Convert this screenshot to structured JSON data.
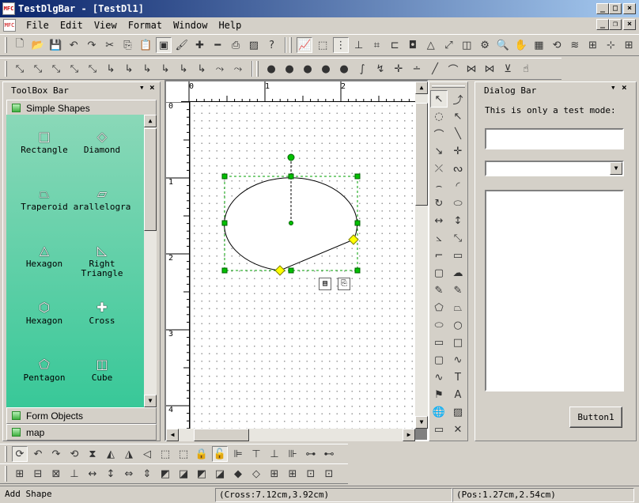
{
  "window": {
    "title": "TestDlgBar - [TestDl1]",
    "icon": "mfc-app-icon"
  },
  "menu": {
    "items": [
      "File",
      "Edit",
      "View",
      "Format",
      "Window",
      "Help"
    ]
  },
  "toolbox": {
    "title": "ToolBox Bar",
    "category_active": "Simple Shapes",
    "shapes": [
      {
        "label": "Rectangle",
        "icon": "rectangle-icon",
        "glyph": "□"
      },
      {
        "label": "Diamond",
        "icon": "diamond-icon",
        "glyph": "◇"
      },
      {
        "label": "Traperoid",
        "icon": "trapezoid-icon",
        "glyph": "⏢"
      },
      {
        "label": "arallelogra",
        "icon": "parallelogram-icon",
        "glyph": "▱"
      },
      {
        "label": "Hexagon",
        "icon": "triangle-icon",
        "glyph": "△"
      },
      {
        "label": "Right Triangle",
        "icon": "right-triangle-icon",
        "glyph": "◺"
      },
      {
        "label": "Hexagon",
        "icon": "hexagon-icon",
        "glyph": "⬡"
      },
      {
        "label": "Cross",
        "icon": "cross-icon",
        "glyph": "✚"
      },
      {
        "label": "Pentagon",
        "icon": "pentagon-icon",
        "glyph": "⬠"
      },
      {
        "label": "Cube",
        "icon": "cube-icon",
        "glyph": "◫"
      }
    ],
    "categories_bottom": [
      "Form Objects",
      "map"
    ]
  },
  "ruler": {
    "h_labels": [
      "0",
      "1",
      "2"
    ],
    "v_labels": [
      "0",
      "1",
      "2",
      "3",
      "4"
    ]
  },
  "dialog_bar": {
    "title": "Dialog Bar",
    "text": "This is only a test mode:",
    "input_value": "",
    "combo_value": "",
    "button_label": "Button1"
  },
  "status": {
    "left": "Add Shape",
    "cross": "(Cross:7.12cm,3.92cm)",
    "pos": "(Pos:1.27cm,2.54cm)"
  },
  "colors": {
    "title_start": "#0a246a",
    "title_end": "#a6caf0",
    "shape_panel": "#38c898",
    "selection_handle": "#00c000",
    "diamond_handle": "#ffff00"
  }
}
